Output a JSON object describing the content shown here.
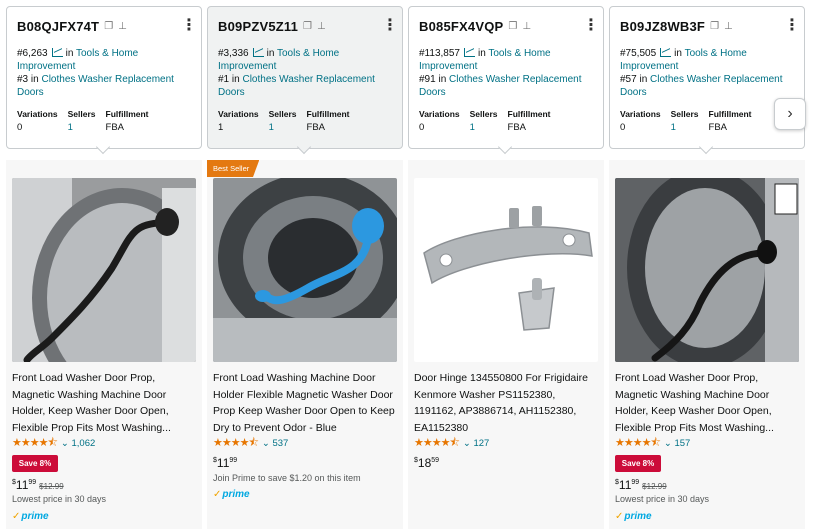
{
  "products": [
    {
      "asin": "B08QJFX74T",
      "rank_tools": "#6,263",
      "rank_tools_cat": "Tools & Home Improvement",
      "rank_sub": "#3",
      "rank_sub_cat": "Clothes Washer Replacement Doors",
      "in_label": "in",
      "variations": "0",
      "sellers": "1",
      "fulfillment": "FBA",
      "badge": "",
      "title": "Front Load Washer Door Prop, Magnetic Washing Machine Door Holder, Keep Washer Door Open, Flexible Prop Fits Most Washing...",
      "rating": 4.5,
      "stars": "★★★★⯪",
      "reviews": "1,062",
      "save": "Save 8%",
      "price_whole": "11",
      "price_frac": "99",
      "price_strike": "$12.99",
      "note": "Lowest price in 30 days",
      "prime": "prime"
    },
    {
      "asin": "B09PZV5Z11",
      "rank_tools": "#3,336",
      "rank_tools_cat": "Tools & Home Improvement",
      "rank_sub": "#1",
      "rank_sub_cat": "Clothes Washer Replacement Doors",
      "in_label": "in",
      "variations": "1",
      "sellers": "1",
      "fulfillment": "FBA",
      "badge": "Best Seller",
      "title": "Front Load Washing Machine Door Holder Flexible Magnetic Washer Door Prop Keep Washer Door Open to Keep Dry to Prevent Odor - Blue",
      "rating": 4.5,
      "stars": "★★★★⯪",
      "reviews": "537",
      "save": "",
      "price_whole": "11",
      "price_frac": "99",
      "price_strike": "",
      "note": "Join Prime to save $1.20 on this item",
      "prime": "prime"
    },
    {
      "asin": "B085FX4VQP",
      "rank_tools": "#113,857",
      "rank_tools_cat": "Tools & Home Improvement",
      "rank_sub": "#91",
      "rank_sub_cat": "Clothes Washer Replacement Doors",
      "in_label": "in",
      "variations": "0",
      "sellers": "1",
      "fulfillment": "FBA",
      "badge": "",
      "title": "Door Hinge 134550800 For Frigidaire Kenmore Washer PS1152380, 1191162, AP3886714, AH1152380, EA1152380",
      "rating": 4.5,
      "stars": "★★★★⯪",
      "reviews": "127",
      "save": "",
      "price_whole": "18",
      "price_frac": "59",
      "price_strike": "",
      "note": "",
      "prime": ""
    },
    {
      "asin": "B09JZ8WB3F",
      "rank_tools": "#75,505",
      "rank_tools_cat": "Tools & Home Improvement",
      "rank_sub": "#57",
      "rank_sub_cat": "Clothes Washer Replacement Doors",
      "in_label": "in",
      "variations": "0",
      "sellers": "1",
      "fulfillment": "FBA",
      "badge": "",
      "title": "Front Load Washer Door Prop, Magnetic Washing Machine Door Holder, Keep Washer Door Open, Flexible Prop Fits Most Washing...",
      "rating": 4.5,
      "stars": "★★★★⯪",
      "reviews": "157",
      "save": "Save 8%",
      "price_whole": "11",
      "price_frac": "99",
      "price_strike": "$12.99",
      "note": "Lowest price in 30 days",
      "prime": "prime"
    }
  ],
  "labels": {
    "variations": "Variations",
    "sellers": "Sellers",
    "fulfillment": "Fulfillment",
    "currency": "$"
  },
  "icons": {
    "copy": "copy-icon",
    "pin": "pin-icon",
    "menu": "more-vertical-icon",
    "trend": "trend-chart-icon",
    "next": "chevron-right-icon"
  },
  "colors": {
    "link": "#007185",
    "star": "#e77600",
    "save_badge": "#cc0c39",
    "best_seller": "#e47911",
    "prime": "#00a8e1"
  },
  "carousel": {
    "next_glyph": "›"
  }
}
